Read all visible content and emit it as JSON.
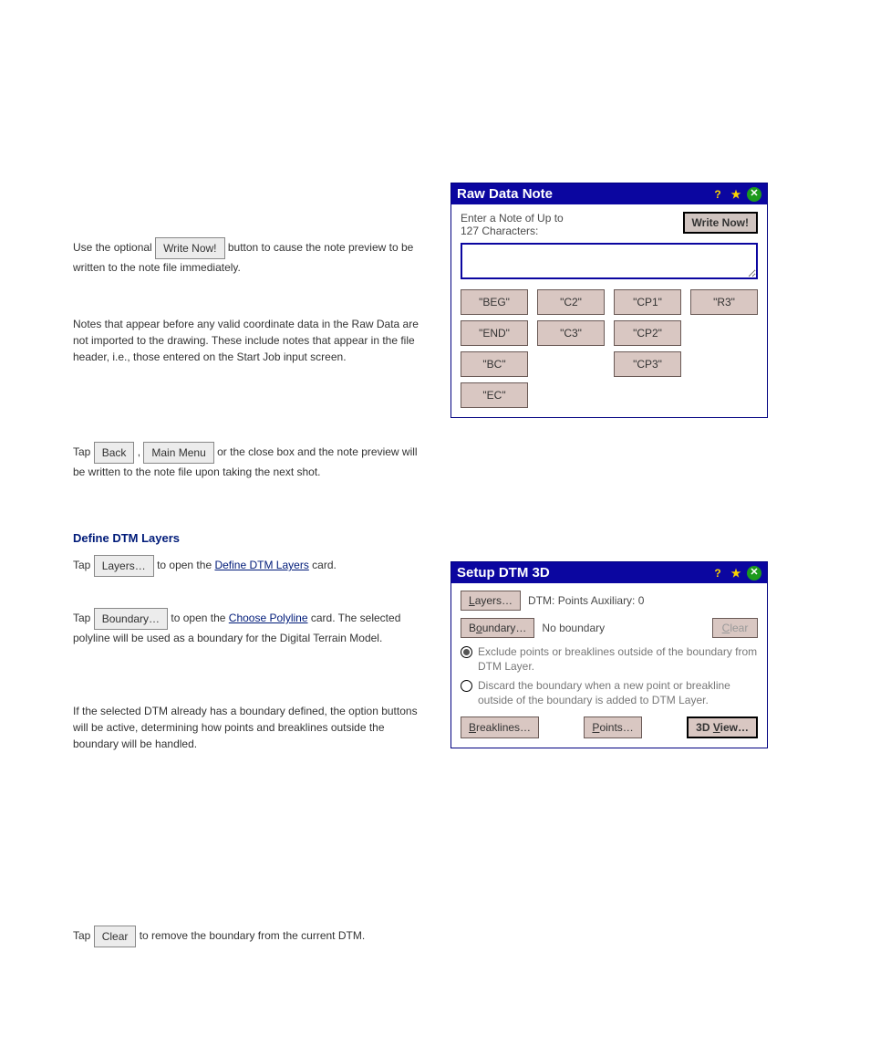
{
  "doc": {
    "line1_prefix": "Use the optional ",
    "line1_btn": "Write Now!",
    "line1_suffix": " button to cause the note preview to be written to the note file immediately.",
    "para2": "Notes that appear before any valid coordinate data in the Raw Data are not imported to the drawing. These include notes that appear in the file header, i.e., those entered on the Start Job input screen.",
    "line3_prefix": "Tap ",
    "line3_btn1": "Back",
    "line3_mid": ", ",
    "line3_btn2": "Main Menu",
    "line3_suffix": " or the close box and the note preview will be written to the note file upon taking the next shot.",
    "header_define": "Define DTM Layers",
    "line4_prefix": "Tap ",
    "line4_btn": "Layers…",
    "line4_mid": " to open the ",
    "line4_link": "Define DTM Layers",
    "line4_suffix": " card.",
    "line5_prefix": "Tap ",
    "line5_btn": "Boundary…",
    "line5_mid": " to open the ",
    "line5_link": "Choose Polyline",
    "line5_suffix": " card. The selected polyline will be used as a boundary for the Digital Terrain Model.",
    "line6": "If the selected DTM already has a boundary defined, the option buttons will be active, determining how points and breaklines outside the boundary will be handled.",
    "line7_prefix": "Tap ",
    "line7_btn": "Clear",
    "line7_suffix": " to remove the boundary from the current DTM."
  },
  "rawNoteDialog": {
    "title": "Raw Data Note",
    "prompt1": "Enter a Note of Up to",
    "prompt2": "127 Characters:",
    "writeNow": "Write Now!",
    "textValue": "",
    "presets": {
      "a1": "\"BEG\"",
      "a2": "\"C2\"",
      "a3": "\"CP1\"",
      "a4": "\"R3\"",
      "b1": "\"END\"",
      "b2": "\"C3\"",
      "b3": "\"CP2\"",
      "c1": "\"BC\"",
      "c3": "\"CP3\"",
      "d1": "\"EC\""
    }
  },
  "setupDialog": {
    "title": "Setup DTM 3D",
    "layersBtn": "Layers…",
    "layersText": "DTM: Points Auxiliary: 0",
    "boundaryBtn": "Boundary…",
    "boundaryText": "No boundary",
    "clearBtn": "Clear",
    "radio1": "Exclude points or breaklines outside of the boundary from DTM Layer.",
    "radio2": "Discard the boundary when a new point or breakline outside of the boundary is added to DTM Layer.",
    "breaklinesBtn": "Breaklines…",
    "pointsBtn": "Points…",
    "viewBtn": "3D View…"
  }
}
